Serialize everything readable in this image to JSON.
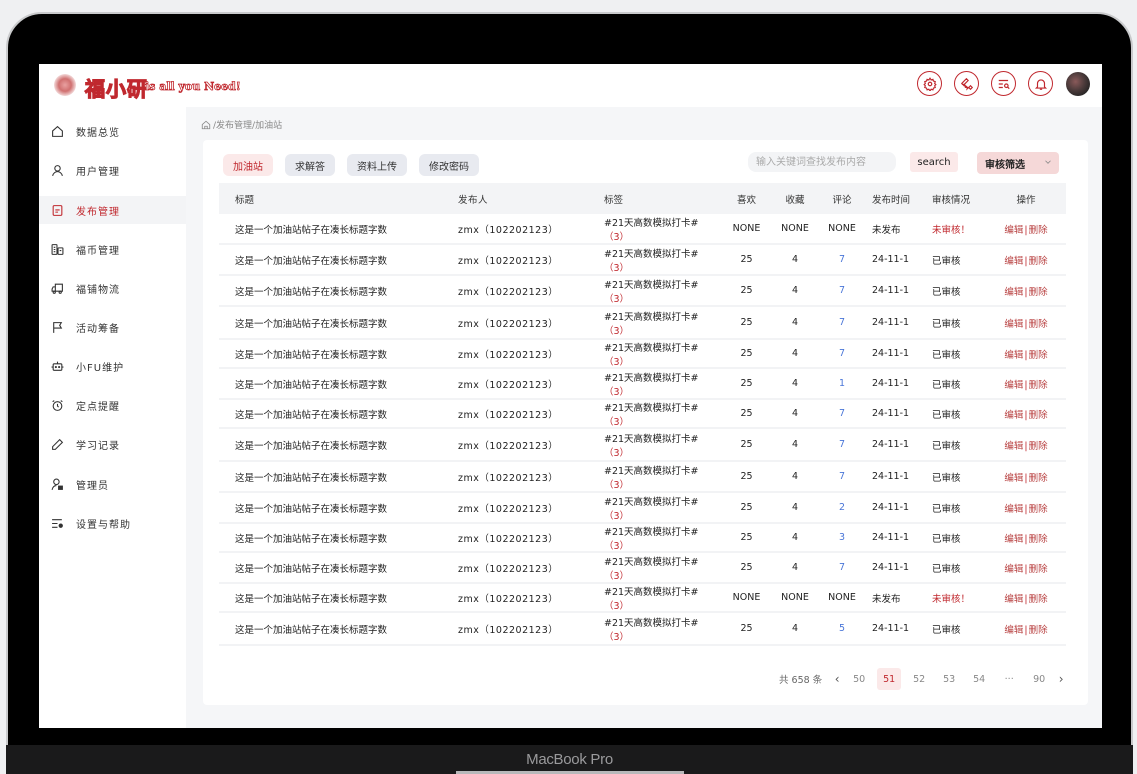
{
  "device": {
    "brand": "MacBook Pro"
  },
  "header": {
    "logo_text": "福小研",
    "slogan": "is all you Need!",
    "icons": [
      "gear-icon",
      "wrench-icon",
      "search-list-icon",
      "bell-icon"
    ],
    "accent": "#c0282e"
  },
  "sidebar": {
    "items": [
      {
        "label": "数据总览",
        "icon": "home-icon",
        "active": false
      },
      {
        "label": "用户管理",
        "icon": "user-icon",
        "active": false
      },
      {
        "label": "发布管理",
        "icon": "document-icon",
        "active": true
      },
      {
        "label": "福币管理",
        "icon": "coins-icon",
        "active": false
      },
      {
        "label": "福铺物流",
        "icon": "truck-icon",
        "active": false
      },
      {
        "label": "活动筹备",
        "icon": "flag-icon",
        "active": false
      },
      {
        "label": "小FU维护",
        "icon": "robot-icon",
        "active": false
      },
      {
        "label": "定点提醒",
        "icon": "alarm-icon",
        "active": false
      },
      {
        "label": "学习记录",
        "icon": "pencil-icon",
        "active": false
      },
      {
        "label": "管理员",
        "icon": "admin-icon",
        "active": false
      },
      {
        "label": "设置与帮助",
        "icon": "settings-list-icon",
        "active": false
      }
    ]
  },
  "breadcrumb": {
    "path": "/发布管理/加油站"
  },
  "tabs": [
    {
      "label": "加油站",
      "active": true
    },
    {
      "label": "求解答",
      "active": false
    },
    {
      "label": "资料上传",
      "active": false
    },
    {
      "label": "修改密码",
      "active": false
    }
  ],
  "search": {
    "placeholder": "输入关键词查找发布内容",
    "value": "",
    "button": "search"
  },
  "filter": {
    "label": "审核筛选"
  },
  "table": {
    "headers": [
      "标题",
      "发布人",
      "标签",
      "喜欢",
      "收藏",
      "评论",
      "发布时间",
      "审核情况",
      "操作"
    ],
    "edit_label": "编辑",
    "separator": "|",
    "delete_label": "删除",
    "rows": [
      {
        "title": "这是一个加油站帖子在凑长标题字数",
        "publisher": "zmx（102202123）",
        "tag": "#21天高数模拟打卡#",
        "tag_count": "（3）",
        "likes": "NONE",
        "favs": "NONE",
        "comments": "NONE",
        "time": "未发布",
        "status": "未审核！",
        "pending": true
      },
      {
        "title": "这是一个加油站帖子在凑长标题字数",
        "publisher": "zmx（102202123）",
        "tag": "#21天高数模拟打卡#",
        "tag_count": "（3）",
        "likes": "25",
        "favs": "4",
        "comments": "7",
        "time": "24-11-1",
        "status": "已审核",
        "pending": false
      },
      {
        "title": "这是一个加油站帖子在凑长标题字数",
        "publisher": "zmx（102202123）",
        "tag": "#21天高数模拟打卡#",
        "tag_count": "（3）",
        "likes": "25",
        "favs": "4",
        "comments": "7",
        "time": "24-11-1",
        "status": "已审核",
        "pending": false
      },
      {
        "title": "这是一个加油站帖子在凑长标题字数",
        "publisher": "zmx（102202123）",
        "tag": "#21天高数模拟打卡#",
        "tag_count": "（3）",
        "likes": "25",
        "favs": "4",
        "comments": "7",
        "time": "24-11-1",
        "status": "已审核",
        "pending": false
      },
      {
        "title": "这是一个加油站帖子在凑长标题字数",
        "publisher": "zmx（102202123）",
        "tag": "#21天高数模拟打卡#",
        "tag_count": "（3）",
        "likes": "25",
        "favs": "4",
        "comments": "7",
        "time": "24-11-1",
        "status": "已审核",
        "pending": false
      },
      {
        "title": "这是一个加油站帖子在凑长标题字数",
        "publisher": "zmx（102202123）",
        "tag": "#21天高数模拟打卡#",
        "tag_count": "（3）",
        "likes": "25",
        "favs": "4",
        "comments": "1",
        "time": "24-11-1",
        "status": "已审核",
        "pending": false
      },
      {
        "title": "这是一个加油站帖子在凑长标题字数",
        "publisher": "zmx（102202123）",
        "tag": "#21天高数模拟打卡#",
        "tag_count": "（3）",
        "likes": "25",
        "favs": "4",
        "comments": "7",
        "time": "24-11-1",
        "status": "已审核",
        "pending": false
      },
      {
        "title": "这是一个加油站帖子在凑长标题字数",
        "publisher": "zmx（102202123）",
        "tag": "#21天高数模拟打卡#",
        "tag_count": "（3）",
        "likes": "25",
        "favs": "4",
        "comments": "7",
        "time": "24-11-1",
        "status": "已审核",
        "pending": false
      },
      {
        "title": "这是一个加油站帖子在凑长标题字数",
        "publisher": "zmx（102202123）",
        "tag": "#21天高数模拟打卡#",
        "tag_count": "（3）",
        "likes": "25",
        "favs": "4",
        "comments": "7",
        "time": "24-11-1",
        "status": "已审核",
        "pending": false
      },
      {
        "title": "这是一个加油站帖子在凑长标题字数",
        "publisher": "zmx（102202123）",
        "tag": "#21天高数模拟打卡#",
        "tag_count": "（3）",
        "likes": "25",
        "favs": "4",
        "comments": "2",
        "time": "24-11-1",
        "status": "已审核",
        "pending": false
      },
      {
        "title": "这是一个加油站帖子在凑长标题字数",
        "publisher": "zmx（102202123）",
        "tag": "#21天高数模拟打卡#",
        "tag_count": "（3）",
        "likes": "25",
        "favs": "4",
        "comments": "3",
        "time": "24-11-1",
        "status": "已审核",
        "pending": false
      },
      {
        "title": "这是一个加油站帖子在凑长标题字数",
        "publisher": "zmx（102202123）",
        "tag": "#21天高数模拟打卡#",
        "tag_count": "（3）",
        "likes": "25",
        "favs": "4",
        "comments": "7",
        "time": "24-11-1",
        "status": "已审核",
        "pending": false
      },
      {
        "title": "这是一个加油站帖子在凑长标题字数",
        "publisher": "zmx（102202123）",
        "tag": "#21天高数模拟打卡#",
        "tag_count": "（3）",
        "likes": "NONE",
        "favs": "NONE",
        "comments": "NONE",
        "time": "未发布",
        "status": "未审核！",
        "pending": true
      },
      {
        "title": "这是一个加油站帖子在凑长标题字数",
        "publisher": "zmx（102202123）",
        "tag": "#21天高数模拟打卡#",
        "tag_count": "（3）",
        "likes": "25",
        "favs": "4",
        "comments": "5",
        "time": "24-11-1",
        "status": "已审核",
        "pending": false
      }
    ]
  },
  "pagination": {
    "total_text": "共 658 条",
    "prev": "‹",
    "next": "›",
    "pages": [
      "50",
      "51",
      "52",
      "53",
      "54",
      "···",
      "90"
    ],
    "current": "51"
  }
}
